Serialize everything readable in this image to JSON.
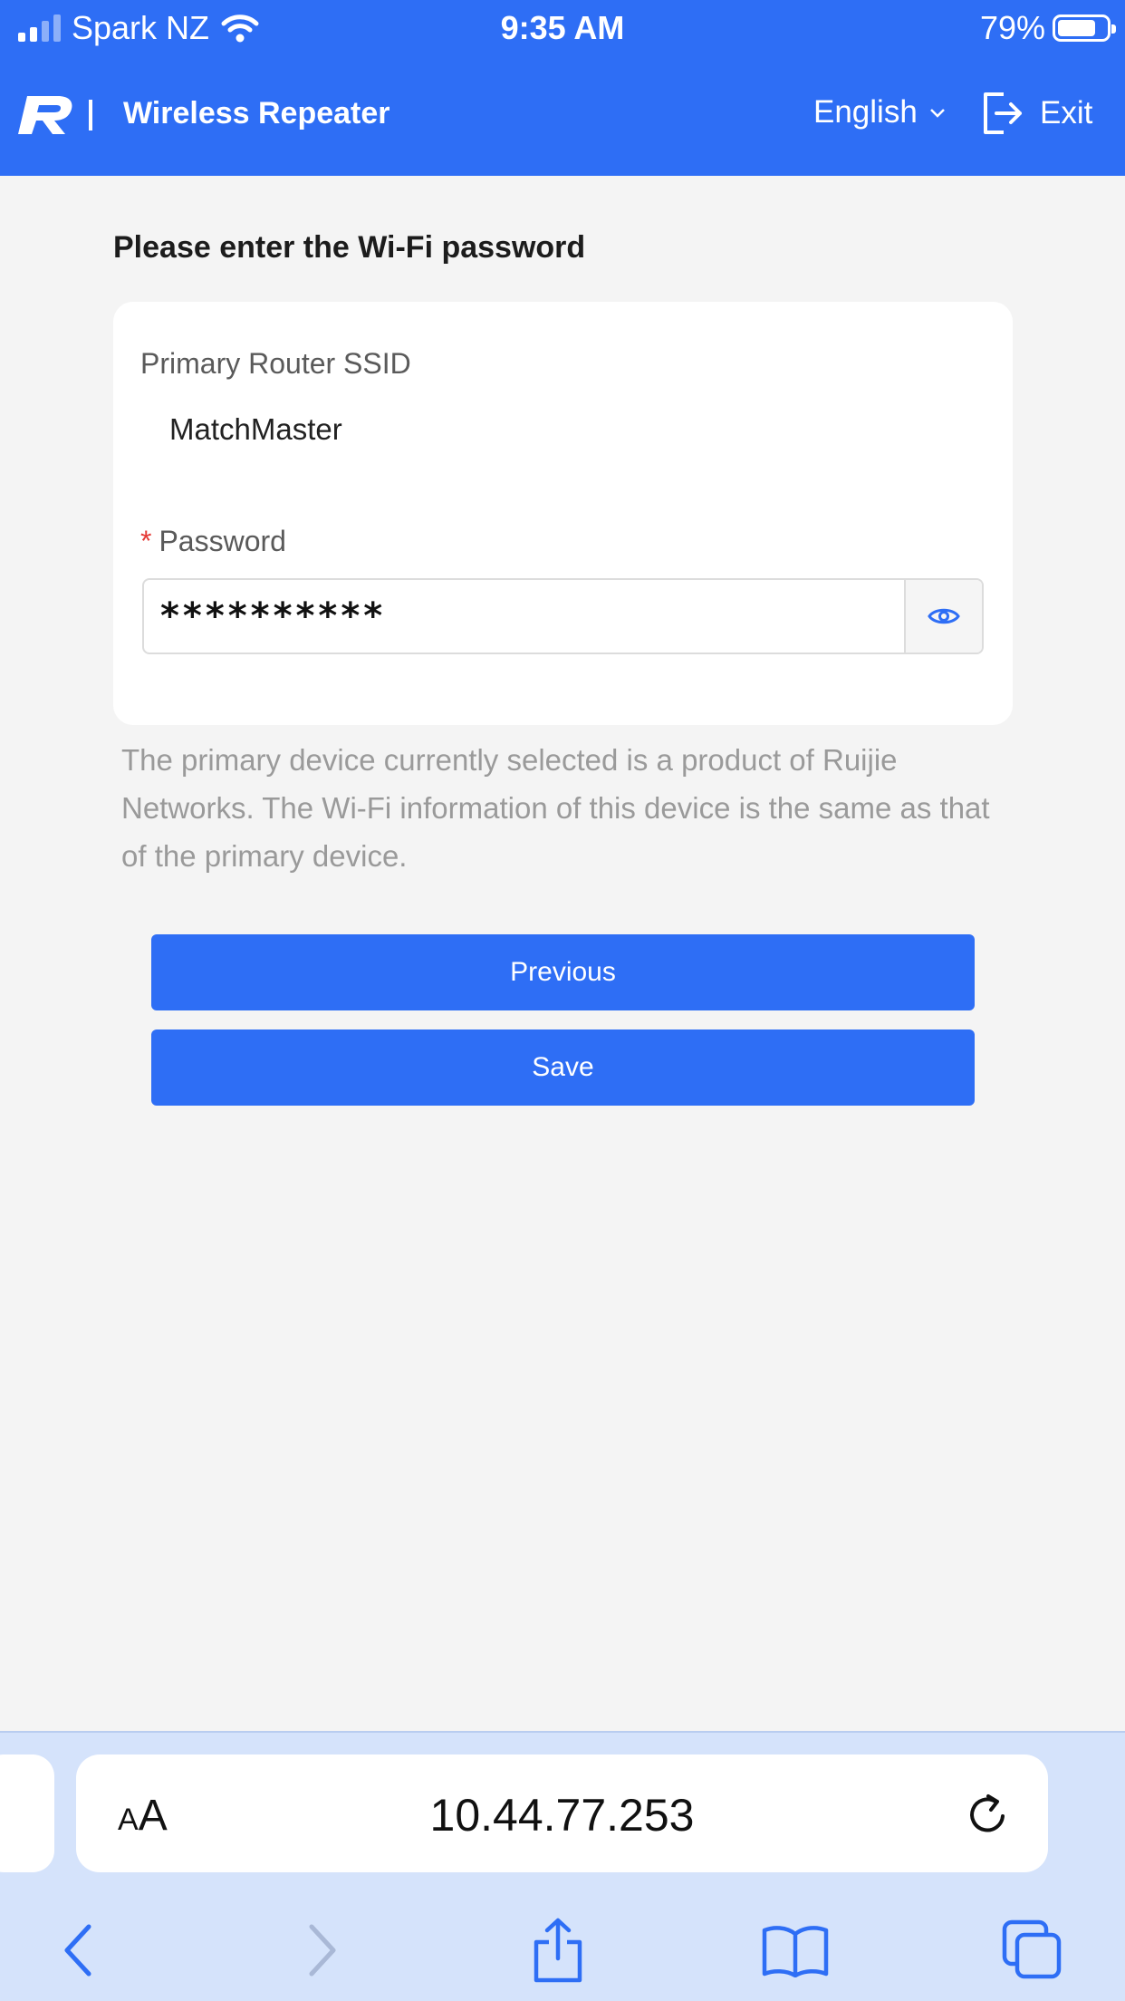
{
  "status_bar": {
    "carrier": "Spark NZ",
    "time": "9:35 AM",
    "battery": "79%",
    "battery_level": 0.79
  },
  "header": {
    "title": "Wireless Repeater",
    "language": "English",
    "exit_label": "Exit",
    "accent_color": "#2e6ef5"
  },
  "form": {
    "heading": "Please enter the Wi-Fi password",
    "ssid_label": "Primary Router SSID",
    "ssid_value": "MatchMaster",
    "password_label": "Password",
    "password_value": "**********",
    "help_text": "The primary device currently selected is a product of Ruijie Networks. The Wi-Fi information of this device is the same as that of the primary device."
  },
  "buttons": {
    "previous": "Previous",
    "save": "Save"
  },
  "browser": {
    "text_size_label": "AA",
    "url": "10.44.77.253"
  }
}
